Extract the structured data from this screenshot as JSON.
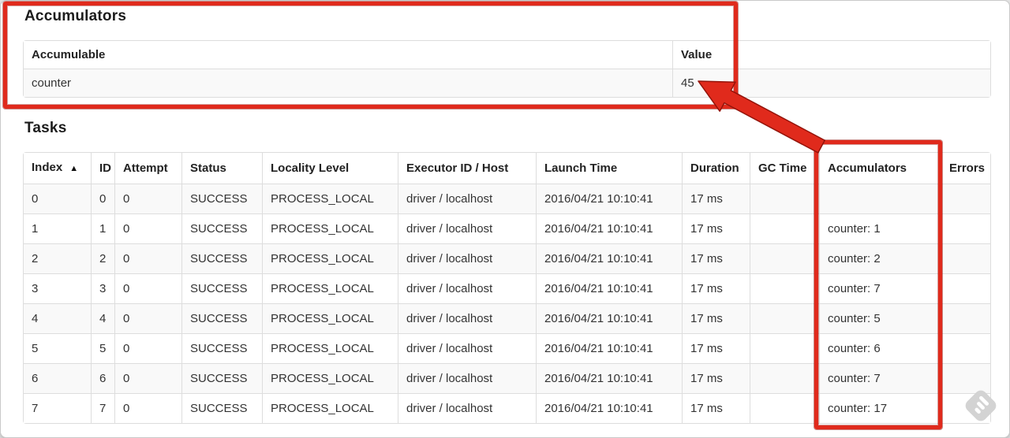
{
  "colors": {
    "annotation_red": "#e02a1c",
    "table_border": "#dddddd",
    "row_stripe": "#f9f9f9",
    "text": "#333333"
  },
  "accumulators_section": {
    "title": "Accumulators",
    "headers": {
      "accumulable": "Accumulable",
      "value": "Value"
    },
    "rows": [
      {
        "accumulable": "counter",
        "value": "45"
      }
    ]
  },
  "tasks_section": {
    "title": "Tasks",
    "headers": {
      "index": "Index",
      "sort_icon": "▲",
      "id": "ID",
      "attempt": "Attempt",
      "status": "Status",
      "locality": "Locality Level",
      "executor": "Executor ID / Host",
      "launch": "Launch Time",
      "duration": "Duration",
      "gc": "GC Time",
      "accumulators": "Accumulators",
      "errors": "Errors"
    },
    "rows": [
      {
        "index": "0",
        "id": "0",
        "attempt": "0",
        "status": "SUCCESS",
        "locality": "PROCESS_LOCAL",
        "executor": "driver / localhost",
        "launch": "2016/04/21 10:10:41",
        "duration": "17 ms",
        "gc": "",
        "accumulators": "",
        "errors": ""
      },
      {
        "index": "1",
        "id": "1",
        "attempt": "0",
        "status": "SUCCESS",
        "locality": "PROCESS_LOCAL",
        "executor": "driver / localhost",
        "launch": "2016/04/21 10:10:41",
        "duration": "17 ms",
        "gc": "",
        "accumulators": "counter: 1",
        "errors": ""
      },
      {
        "index": "2",
        "id": "2",
        "attempt": "0",
        "status": "SUCCESS",
        "locality": "PROCESS_LOCAL",
        "executor": "driver / localhost",
        "launch": "2016/04/21 10:10:41",
        "duration": "17 ms",
        "gc": "",
        "accumulators": "counter: 2",
        "errors": ""
      },
      {
        "index": "3",
        "id": "3",
        "attempt": "0",
        "status": "SUCCESS",
        "locality": "PROCESS_LOCAL",
        "executor": "driver / localhost",
        "launch": "2016/04/21 10:10:41",
        "duration": "17 ms",
        "gc": "",
        "accumulators": "counter: 7",
        "errors": ""
      },
      {
        "index": "4",
        "id": "4",
        "attempt": "0",
        "status": "SUCCESS",
        "locality": "PROCESS_LOCAL",
        "executor": "driver / localhost",
        "launch": "2016/04/21 10:10:41",
        "duration": "17 ms",
        "gc": "",
        "accumulators": "counter: 5",
        "errors": ""
      },
      {
        "index": "5",
        "id": "5",
        "attempt": "0",
        "status": "SUCCESS",
        "locality": "PROCESS_LOCAL",
        "executor": "driver / localhost",
        "launch": "2016/04/21 10:10:41",
        "duration": "17 ms",
        "gc": "",
        "accumulators": "counter: 6",
        "errors": ""
      },
      {
        "index": "6",
        "id": "6",
        "attempt": "0",
        "status": "SUCCESS",
        "locality": "PROCESS_LOCAL",
        "executor": "driver / localhost",
        "launch": "2016/04/21 10:10:41",
        "duration": "17 ms",
        "gc": "",
        "accumulators": "counter: 7",
        "errors": ""
      },
      {
        "index": "7",
        "id": "7",
        "attempt": "0",
        "status": "SUCCESS",
        "locality": "PROCESS_LOCAL",
        "executor": "driver / localhost",
        "launch": "2016/04/21 10:10:41",
        "duration": "17 ms",
        "gc": "",
        "accumulators": "counter: 17",
        "errors": ""
      }
    ]
  },
  "annotations": {
    "boxed_regions": [
      "accumulators-summary-table",
      "tasks-accumulators-column"
    ],
    "arrow_points_to": "accumulator total value 45"
  },
  "icons": {
    "sort_ascending": "sort-ascending-icon",
    "watermark": "feedly-watermark-icon"
  }
}
